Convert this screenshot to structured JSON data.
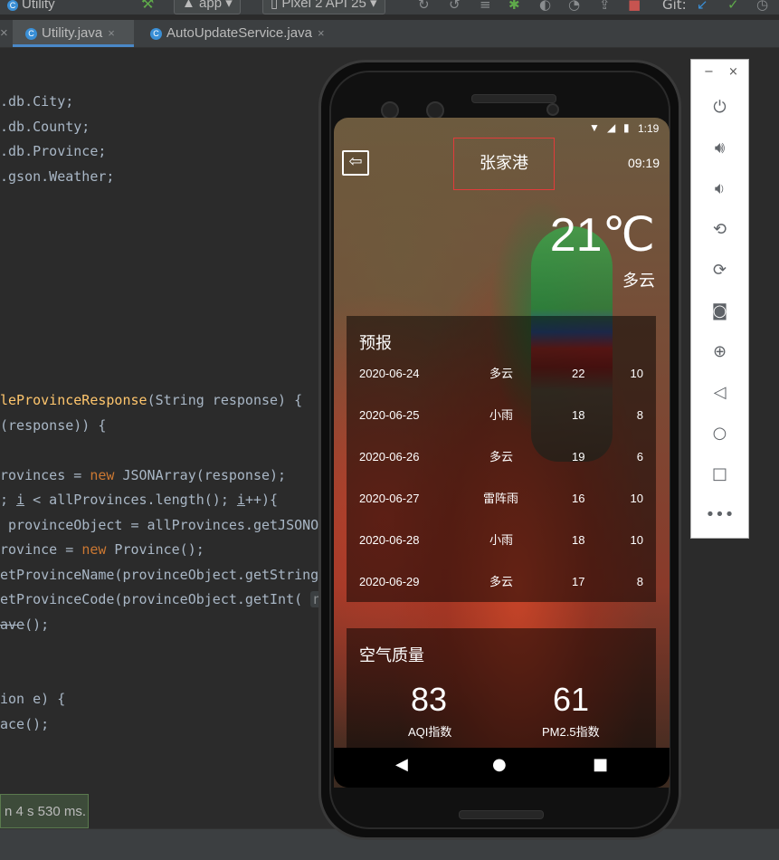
{
  "ide": {
    "project_title": "Utility",
    "run_config": "app",
    "device": "Pixel 2 API 25",
    "git_label": "Git:",
    "tabs": [
      {
        "label": "Utility.java",
        "active": true
      },
      {
        "label": "AutoUpdateService.java",
        "active": false
      }
    ],
    "toast": "n 4 s 530 ms."
  },
  "code": [
    {
      "text": ".db.City;"
    },
    {
      "text": ".db.County;"
    },
    {
      "text": ".db.Province;"
    },
    {
      "text": ".gson.Weather;"
    }
  ],
  "code_b": {
    "l1_fn": "leProvinceResponse",
    "l1_rest": "(String response) {",
    "l2": "(response)) {",
    "l3_a": "rovinces = ",
    "l3_kw": "new",
    "l3_b": " JSONArray(response);",
    "l4_a": "; ",
    "l4_i": "i",
    "l4_b": " < allProvinces.length(); ",
    "l4_i2": "i",
    "l4_c": "++){",
    "l5": " provinceObject = allProvinces.getJSONO",
    "l6_a": "rovince = ",
    "l6_kw": "new",
    "l6_b": " Province();",
    "l7": "etProvinceName(provinceObject.getString",
    "l8_a": "etProvinceCode(provinceObject.getInt( ",
    "l8_hint": "n",
    "l9_a": "ave",
    "l9_b": "();",
    "l10": "ion e) {",
    "l11_a": "ace",
    "l11_b": "();"
  },
  "emulator_panel": {
    "minimize": "−",
    "close": "×",
    "buttons": [
      "power-icon",
      "volume-up-icon",
      "volume-down-icon",
      "rotate-left-icon",
      "rotate-right-icon",
      "camera-icon",
      "zoom-icon",
      "back-icon",
      "home-icon",
      "overview-icon",
      "more-icon"
    ]
  },
  "phone": {
    "status_time": "1:19",
    "city": "张家港",
    "update_time": "09:19",
    "degree": "21℃",
    "weather_info": "多云",
    "forecast_title": "预报",
    "forecast": [
      {
        "date": "2020-06-24",
        "info": "多云",
        "max": "22",
        "min": "10"
      },
      {
        "date": "2020-06-25",
        "info": "小雨",
        "max": "18",
        "min": "8"
      },
      {
        "date": "2020-06-26",
        "info": "多云",
        "max": "19",
        "min": "6"
      },
      {
        "date": "2020-06-27",
        "info": "雷阵雨",
        "max": "16",
        "min": "10"
      },
      {
        "date": "2020-06-28",
        "info": "小雨",
        "max": "18",
        "min": "10"
      },
      {
        "date": "2020-06-29",
        "info": "多云",
        "max": "17",
        "min": "8"
      }
    ],
    "aqi_title": "空气质量",
    "aqi_value": "83",
    "aqi_label": "AQI指数",
    "pm25_value": "61",
    "pm25_label": "PM2.5指数"
  }
}
